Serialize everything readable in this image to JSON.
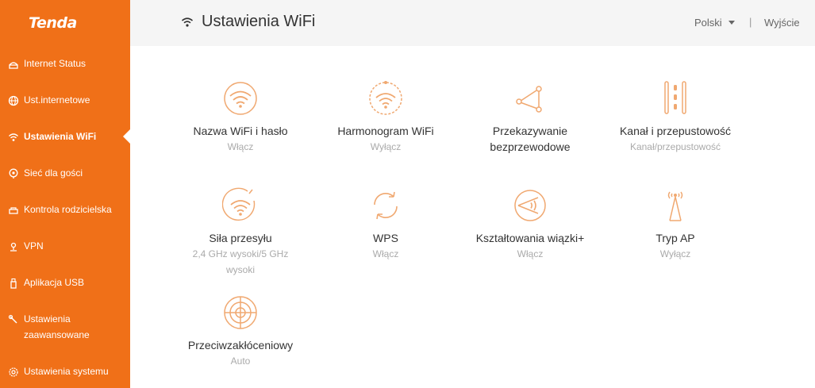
{
  "brand": {
    "logo": "Tenda",
    "accent": "#f07018"
  },
  "header": {
    "title": "Ustawienia WiFi",
    "language": "Polski",
    "separator": "|",
    "exit": "Wyjście"
  },
  "sidebar": {
    "items": [
      {
        "label": "Internet Status",
        "icon": "globe-status-icon"
      },
      {
        "label": "Ust.internetowe",
        "icon": "globe-icon"
      },
      {
        "label": "Ustawienia WiFi",
        "icon": "wifi-icon",
        "active": true
      },
      {
        "label": "Sieć dla gości",
        "icon": "guest-icon"
      },
      {
        "label": "Kontrola rodzicielska",
        "icon": "parental-icon"
      },
      {
        "label": "VPN",
        "icon": "vpn-icon"
      },
      {
        "label": "Aplikacja USB",
        "icon": "usb-icon"
      },
      {
        "label": "Ustawienia zaawansowane",
        "icon": "wrench-icon"
      },
      {
        "label": "Ustawienia systemu",
        "icon": "gear-icon"
      }
    ]
  },
  "tiles": [
    {
      "title": "Nazwa WiFi i hasło",
      "status": "Włącz",
      "icon": "wifi-circle-icon"
    },
    {
      "title": "Harmonogram WiFi",
      "status": "Wyłącz",
      "icon": "wifi-clock-icon"
    },
    {
      "title": "Przekazywanie bezprzewodowe",
      "status": "",
      "icon": "relay-icon"
    },
    {
      "title": "Kanał i przepustowość",
      "status": "Kanał/przepustowość",
      "icon": "channel-icon"
    },
    {
      "title": "Siła przesyłu",
      "status": "2,4 GHz wysoki/5 GHz wysoki",
      "icon": "signal-strength-icon"
    },
    {
      "title": "WPS",
      "status": "Włącz",
      "icon": "wps-icon"
    },
    {
      "title": "Kształtowania wiązki+",
      "status": "Włącz",
      "icon": "beamforming-icon"
    },
    {
      "title": "Tryp AP",
      "status": "Wyłącz",
      "icon": "antenna-icon"
    },
    {
      "title": "Przeciwzakłóceniowy",
      "status": "Auto",
      "icon": "anti-interference-icon"
    }
  ]
}
